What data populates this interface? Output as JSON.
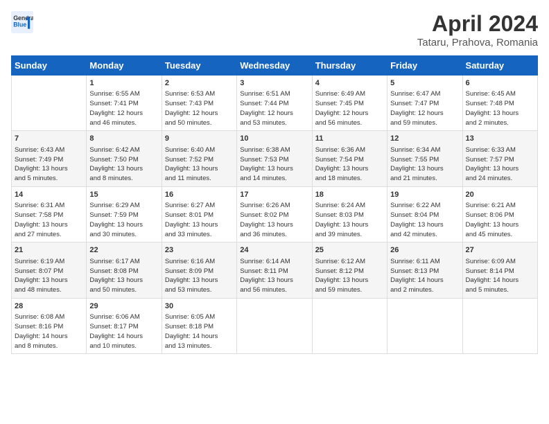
{
  "header": {
    "logo_line1": "General",
    "logo_line2": "Blue",
    "title": "April 2024",
    "subtitle": "Tataru, Prahova, Romania"
  },
  "days_of_week": [
    "Sunday",
    "Monday",
    "Tuesday",
    "Wednesday",
    "Thursday",
    "Friday",
    "Saturday"
  ],
  "weeks": [
    [
      {
        "day": "",
        "lines": []
      },
      {
        "day": "1",
        "lines": [
          "Sunrise: 6:55 AM",
          "Sunset: 7:41 PM",
          "Daylight: 12 hours",
          "and 46 minutes."
        ]
      },
      {
        "day": "2",
        "lines": [
          "Sunrise: 6:53 AM",
          "Sunset: 7:43 PM",
          "Daylight: 12 hours",
          "and 50 minutes."
        ]
      },
      {
        "day": "3",
        "lines": [
          "Sunrise: 6:51 AM",
          "Sunset: 7:44 PM",
          "Daylight: 12 hours",
          "and 53 minutes."
        ]
      },
      {
        "day": "4",
        "lines": [
          "Sunrise: 6:49 AM",
          "Sunset: 7:45 PM",
          "Daylight: 12 hours",
          "and 56 minutes."
        ]
      },
      {
        "day": "5",
        "lines": [
          "Sunrise: 6:47 AM",
          "Sunset: 7:47 PM",
          "Daylight: 12 hours",
          "and 59 minutes."
        ]
      },
      {
        "day": "6",
        "lines": [
          "Sunrise: 6:45 AM",
          "Sunset: 7:48 PM",
          "Daylight: 13 hours",
          "and 2 minutes."
        ]
      }
    ],
    [
      {
        "day": "7",
        "lines": [
          "Sunrise: 6:43 AM",
          "Sunset: 7:49 PM",
          "Daylight: 13 hours",
          "and 5 minutes."
        ]
      },
      {
        "day": "8",
        "lines": [
          "Sunrise: 6:42 AM",
          "Sunset: 7:50 PM",
          "Daylight: 13 hours",
          "and 8 minutes."
        ]
      },
      {
        "day": "9",
        "lines": [
          "Sunrise: 6:40 AM",
          "Sunset: 7:52 PM",
          "Daylight: 13 hours",
          "and 11 minutes."
        ]
      },
      {
        "day": "10",
        "lines": [
          "Sunrise: 6:38 AM",
          "Sunset: 7:53 PM",
          "Daylight: 13 hours",
          "and 14 minutes."
        ]
      },
      {
        "day": "11",
        "lines": [
          "Sunrise: 6:36 AM",
          "Sunset: 7:54 PM",
          "Daylight: 13 hours",
          "and 18 minutes."
        ]
      },
      {
        "day": "12",
        "lines": [
          "Sunrise: 6:34 AM",
          "Sunset: 7:55 PM",
          "Daylight: 13 hours",
          "and 21 minutes."
        ]
      },
      {
        "day": "13",
        "lines": [
          "Sunrise: 6:33 AM",
          "Sunset: 7:57 PM",
          "Daylight: 13 hours",
          "and 24 minutes."
        ]
      }
    ],
    [
      {
        "day": "14",
        "lines": [
          "Sunrise: 6:31 AM",
          "Sunset: 7:58 PM",
          "Daylight: 13 hours",
          "and 27 minutes."
        ]
      },
      {
        "day": "15",
        "lines": [
          "Sunrise: 6:29 AM",
          "Sunset: 7:59 PM",
          "Daylight: 13 hours",
          "and 30 minutes."
        ]
      },
      {
        "day": "16",
        "lines": [
          "Sunrise: 6:27 AM",
          "Sunset: 8:01 PM",
          "Daylight: 13 hours",
          "and 33 minutes."
        ]
      },
      {
        "day": "17",
        "lines": [
          "Sunrise: 6:26 AM",
          "Sunset: 8:02 PM",
          "Daylight: 13 hours",
          "and 36 minutes."
        ]
      },
      {
        "day": "18",
        "lines": [
          "Sunrise: 6:24 AM",
          "Sunset: 8:03 PM",
          "Daylight: 13 hours",
          "and 39 minutes."
        ]
      },
      {
        "day": "19",
        "lines": [
          "Sunrise: 6:22 AM",
          "Sunset: 8:04 PM",
          "Daylight: 13 hours",
          "and 42 minutes."
        ]
      },
      {
        "day": "20",
        "lines": [
          "Sunrise: 6:21 AM",
          "Sunset: 8:06 PM",
          "Daylight: 13 hours",
          "and 45 minutes."
        ]
      }
    ],
    [
      {
        "day": "21",
        "lines": [
          "Sunrise: 6:19 AM",
          "Sunset: 8:07 PM",
          "Daylight: 13 hours",
          "and 48 minutes."
        ]
      },
      {
        "day": "22",
        "lines": [
          "Sunrise: 6:17 AM",
          "Sunset: 8:08 PM",
          "Daylight: 13 hours",
          "and 50 minutes."
        ]
      },
      {
        "day": "23",
        "lines": [
          "Sunrise: 6:16 AM",
          "Sunset: 8:09 PM",
          "Daylight: 13 hours",
          "and 53 minutes."
        ]
      },
      {
        "day": "24",
        "lines": [
          "Sunrise: 6:14 AM",
          "Sunset: 8:11 PM",
          "Daylight: 13 hours",
          "and 56 minutes."
        ]
      },
      {
        "day": "25",
        "lines": [
          "Sunrise: 6:12 AM",
          "Sunset: 8:12 PM",
          "Daylight: 13 hours",
          "and 59 minutes."
        ]
      },
      {
        "day": "26",
        "lines": [
          "Sunrise: 6:11 AM",
          "Sunset: 8:13 PM",
          "Daylight: 14 hours",
          "and 2 minutes."
        ]
      },
      {
        "day": "27",
        "lines": [
          "Sunrise: 6:09 AM",
          "Sunset: 8:14 PM",
          "Daylight: 14 hours",
          "and 5 minutes."
        ]
      }
    ],
    [
      {
        "day": "28",
        "lines": [
          "Sunrise: 6:08 AM",
          "Sunset: 8:16 PM",
          "Daylight: 14 hours",
          "and 8 minutes."
        ]
      },
      {
        "day": "29",
        "lines": [
          "Sunrise: 6:06 AM",
          "Sunset: 8:17 PM",
          "Daylight: 14 hours",
          "and 10 minutes."
        ]
      },
      {
        "day": "30",
        "lines": [
          "Sunrise: 6:05 AM",
          "Sunset: 8:18 PM",
          "Daylight: 14 hours",
          "and 13 minutes."
        ]
      },
      {
        "day": "",
        "lines": []
      },
      {
        "day": "",
        "lines": []
      },
      {
        "day": "",
        "lines": []
      },
      {
        "day": "",
        "lines": []
      }
    ]
  ]
}
